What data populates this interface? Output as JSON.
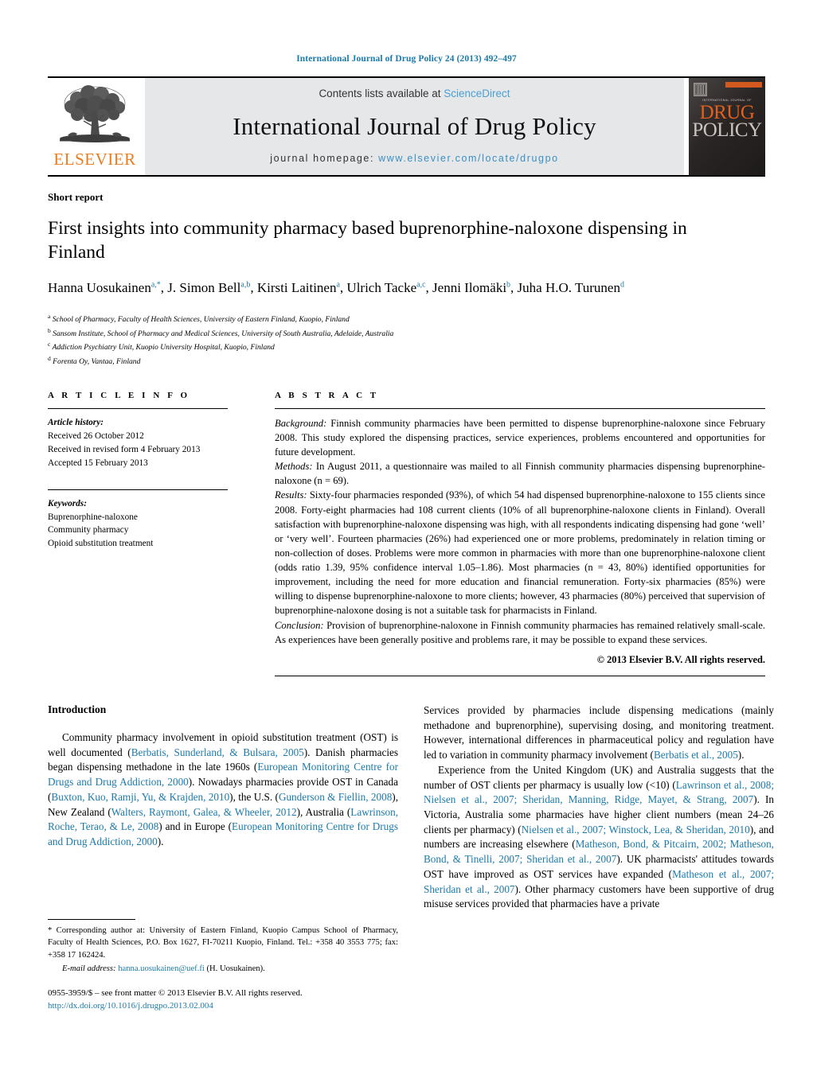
{
  "running_head": "International Journal of Drug Policy 24 (2013) 492–497",
  "masthead": {
    "publisher": "ELSEVIER",
    "contents_prefix": "Contents lists available at ",
    "contents_link": "ScienceDirect",
    "journal_title": "International Journal of Drug Policy",
    "homepage_prefix": "journal homepage:",
    "homepage_url": "www.elsevier.com/locate/drugpo",
    "cover": {
      "kicker": "INTERNATIONAL JOURNAL OF",
      "line1": "DRUG",
      "line2": "POLICY",
      "accent_color": "#e2601c"
    }
  },
  "article": {
    "kind": "Short report",
    "title": "First insights into community pharmacy based buprenorphine-naloxone dispensing in Finland",
    "authors": [
      {
        "name": "Hanna Uosukainen",
        "marks": "a,*"
      },
      {
        "name": "J. Simon Bell",
        "marks": "a,b"
      },
      {
        "name": "Kirsti Laitinen",
        "marks": "a"
      },
      {
        "name": "Ulrich Tacke",
        "marks": "a,c"
      },
      {
        "name": "Jenni Ilomäki",
        "marks": "b"
      },
      {
        "name": "Juha H.O. Turunen",
        "marks": "d"
      }
    ],
    "affiliations": [
      {
        "mark": "a",
        "text": "School of Pharmacy, Faculty of Health Sciences, University of Eastern Finland, Kuopio, Finland"
      },
      {
        "mark": "b",
        "text": "Sansom Institute, School of Pharmacy and Medical Sciences, University of South Australia, Adelaide, Australia"
      },
      {
        "mark": "c",
        "text": "Addiction Psychiatry Unit, Kuopio University Hospital, Kuopio, Finland"
      },
      {
        "mark": "d",
        "text": "Forenta Oy, Vantaa, Finland"
      }
    ]
  },
  "article_info": {
    "heading": "A R T I C L E   I N F O",
    "history_label": "Article history:",
    "history": [
      "Received 26 October 2012",
      "Received in revised form 4 February 2013",
      "Accepted 15 February 2013"
    ],
    "keywords_label": "Keywords:",
    "keywords": [
      "Buprenorphine-naloxone",
      "Community pharmacy",
      "Opioid substitution treatment"
    ]
  },
  "abstract": {
    "heading": "A B S T R A C T",
    "sections": [
      {
        "label": "Background:",
        "text": " Finnish community pharmacies have been permitted to dispense buprenorphine-naloxone since February 2008. This study explored the dispensing practices, service experiences, problems encountered and opportunities for future development."
      },
      {
        "label": "Methods:",
        "text": " In August 2011, a questionnaire was mailed to all Finnish community pharmacies dispensing buprenorphine-naloxone (n = 69)."
      },
      {
        "label": "Results:",
        "text": " Sixty-four pharmacies responded (93%), of which 54 had dispensed buprenorphine-naloxone to 155 clients since 2008. Forty-eight pharmacies had 108 current clients (10% of all buprenorphine-naloxone clients in Finland). Overall satisfaction with buprenorphine-naloxone dispensing was high, with all respondents indicating dispensing had gone ‘well’ or ‘very well’. Fourteen pharmacies (26%) had experienced one or more problems, predominately in relation timing or non-collection of doses. Problems were more common in pharmacies with more than one buprenorphine-naloxone client (odds ratio 1.39, 95% confidence interval 1.05–1.86). Most pharmacies (n = 43, 80%) identified opportunities for improvement, including the need for more education and financial remuneration. Forty-six pharmacies (85%) were willing to dispense buprenorphine-naloxone to more clients; however, 43 pharmacies (80%) perceived that supervision of buprenorphine-naloxone dosing is not a suitable task for pharmacists in Finland."
      },
      {
        "label": "Conclusion:",
        "text": " Provision of buprenorphine-naloxone in Finnish community pharmacies has remained relatively small-scale. As experiences have been generally positive and problems rare, it may be possible to expand these services."
      }
    ],
    "copyright": "© 2013 Elsevier B.V. All rights reserved."
  },
  "body": {
    "left_heading": "Introduction",
    "left_paragraph_1_a": "Community pharmacy involvement in opioid substitution treatment (OST) is well documented (",
    "left_ref_1": "Berbatis, Sunderland, & Bulsara, 2005",
    "left_paragraph_1_b": "). Danish pharmacies began dispensing methadone in the late 1960s (",
    "left_ref_2": "European Monitoring Centre for Drugs and Drug Addiction, 2000",
    "left_paragraph_1_c": "). Nowadays pharmacies provide OST in Canada (",
    "left_ref_3": "Buxton, Kuo, Ramji, Yu, & Krajden, 2010",
    "left_paragraph_1_d": "), the U.S. (",
    "left_ref_4": "Gunderson & Fiellin, 2008",
    "left_paragraph_1_e": "), New Zealand (",
    "left_ref_5": "Walters, Raymont, Galea, & Wheeler, 2012",
    "left_paragraph_1_f": "), Australia (",
    "left_ref_6": "Lawrinson, Roche, Terao, & Le, 2008",
    "left_paragraph_1_g": ") and in Europe (",
    "left_ref_7": "European Monitoring Centre for Drugs and Drug Addiction, 2000",
    "left_paragraph_1_h": ").",
    "right_paragraph_1_a": "Services provided by pharmacies include dispensing medications (mainly methadone and buprenorphine), supervising dosing, and monitoring treatment. However, international differences in pharmaceutical policy and regulation have led to variation in community pharmacy involvement (",
    "right_ref_1": "Berbatis et al., 2005",
    "right_paragraph_1_b": ").",
    "right_paragraph_2_a": "Experience from the United Kingdom (UK) and Australia suggests that the number of OST clients per pharmacy is usually low (<10) (",
    "right_ref_2": "Lawrinson et al., 2008; Nielsen et al., 2007; Sheridan, Manning, Ridge, Mayet, & Strang, 2007",
    "right_paragraph_2_b": "). In Victoria, Australia some pharmacies have higher client numbers (mean 24–26 clients per pharmacy) (",
    "right_ref_3": "Nielsen et al., 2007; Winstock, Lea, & Sheridan, 2010",
    "right_paragraph_2_c": "), and numbers are increasing elsewhere (",
    "right_ref_4": "Matheson, Bond, & Pitcairn, 2002; Matheson, Bond, & Tinelli, 2007; Sheridan et al., 2007",
    "right_paragraph_2_d": "). UK pharmacists' attitudes towards OST have improved as OST services have expanded (",
    "right_ref_5": "Matheson et al., 2007; Sheridan et al., 2007",
    "right_paragraph_2_e": "). Other pharmacy customers have been supportive of drug misuse services provided that pharmacies have a private"
  },
  "footnotes": {
    "corresponding": "* Corresponding author at: University of Eastern Finland, Kuopio Campus School of Pharmacy, Faculty of Health Sciences, P.O. Box 1627, FI-70211 Kuopio, Finland. Tel.: +358 40 3553 775; fax: +358 17 162424.",
    "email_label": "E-mail address:",
    "email": "hanna.uosukainen@uef.fi",
    "email_suffix": " (H. Uosukainen).",
    "issn_line": "0955-3959/$ – see front matter © 2013 Elsevier B.V. All rights reserved.",
    "doi": "http://dx.doi.org/10.1016/j.drugpo.2013.02.004"
  }
}
